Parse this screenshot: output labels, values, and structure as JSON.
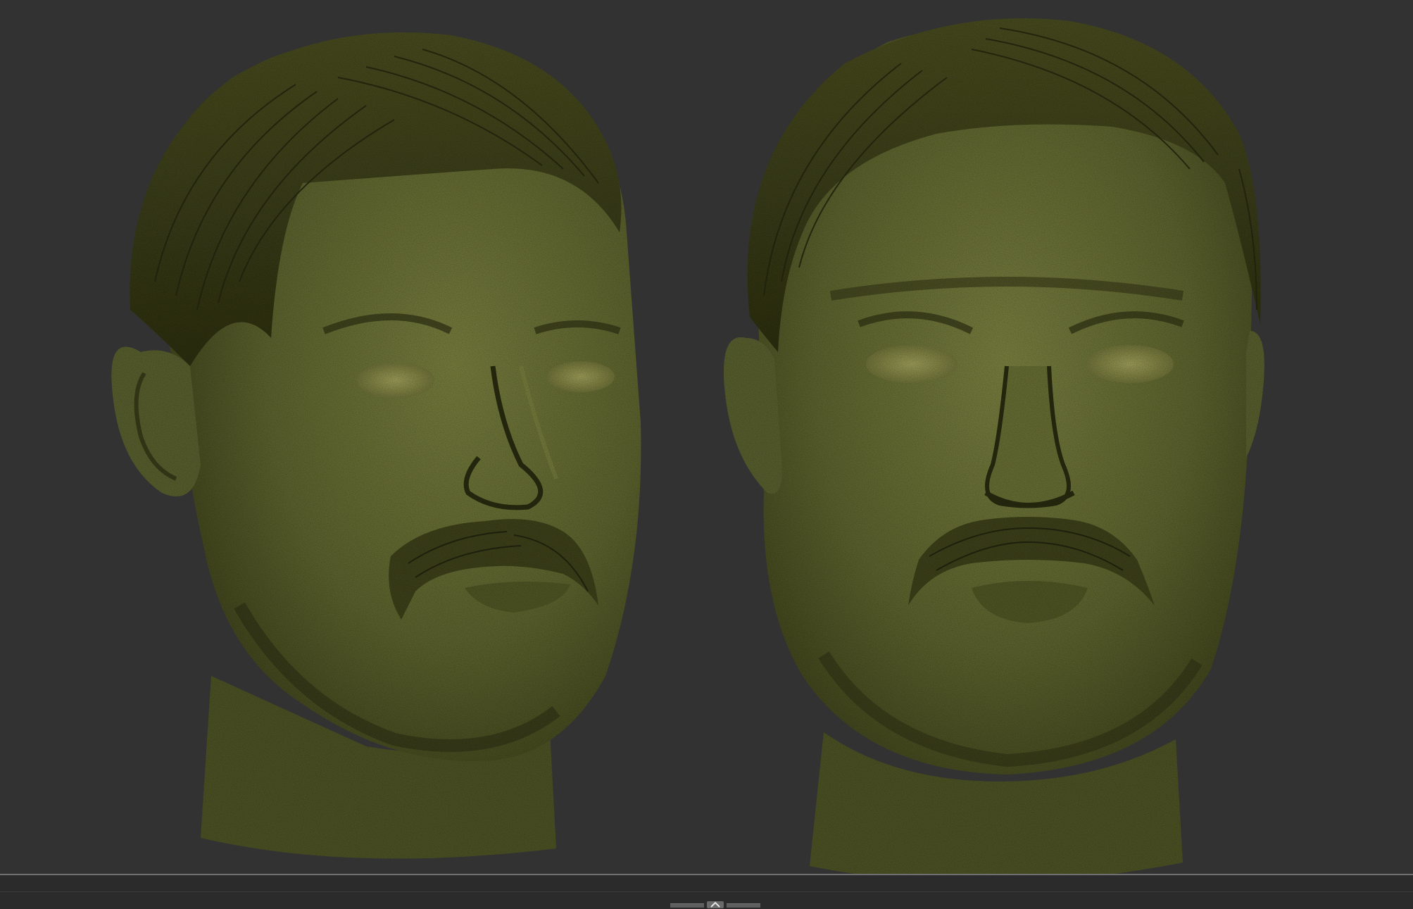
{
  "app": {
    "view": "3D viewport",
    "background_color": "#323232"
  },
  "viewport": {
    "models": [
      {
        "name": "head-sculpt-three-quarter-view",
        "material_color": "#5a5e28"
      },
      {
        "name": "head-sculpt-front-view",
        "material_color": "#5a5e28"
      }
    ]
  },
  "bottom_tray": {
    "handle_icon": "chevron-up-icon"
  }
}
